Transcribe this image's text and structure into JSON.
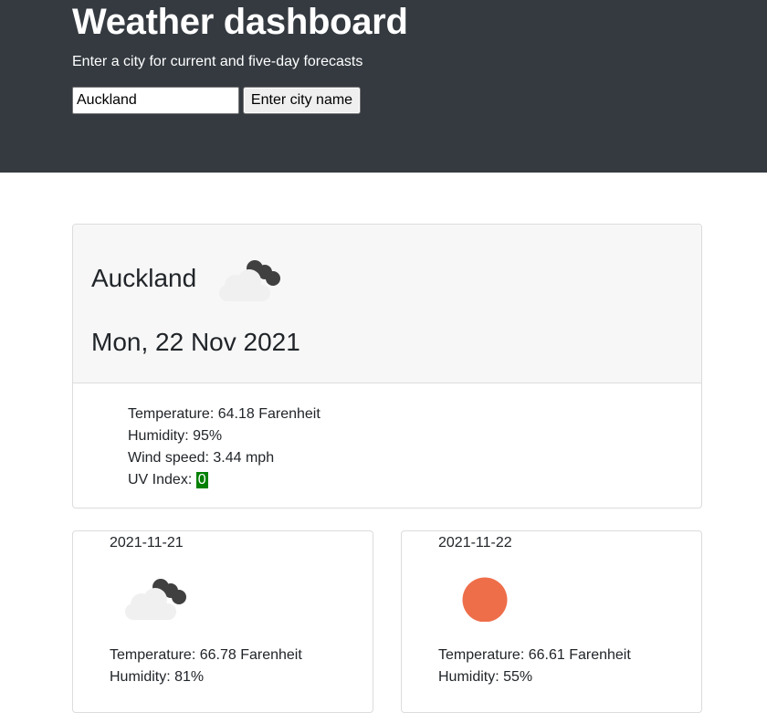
{
  "header": {
    "title": "Weather dashboard",
    "subtitle": "Enter a city for current and five-day forecasts"
  },
  "search": {
    "value": "Auckland",
    "button_label": "Enter city name"
  },
  "current": {
    "city": "Auckland",
    "date": "Mon, 22 Nov 2021",
    "icon": "cloudy-icon",
    "temperature": "Temperature: 64.18 Farenheit",
    "humidity": "Humidity: 95%",
    "wind": "Wind speed: 3.44 mph",
    "uv_label": "UV Index: ",
    "uv_value": "0",
    "uv_color": "#008000"
  },
  "forecast": [
    {
      "date": "2021-11-21",
      "icon": "cloudy-icon",
      "temperature": "Temperature: 66.78 Farenheit",
      "humidity": "Humidity: 81%"
    },
    {
      "date": "2021-11-22",
      "icon": "sun-icon",
      "temperature": "Temperature: 66.61 Farenheit",
      "humidity": "Humidity: 55%"
    }
  ],
  "colors": {
    "header_bg": "#343a40",
    "sun": "#ee6e4a",
    "cloud_dark": "#404040",
    "cloud_light": "#f0f0f0"
  }
}
